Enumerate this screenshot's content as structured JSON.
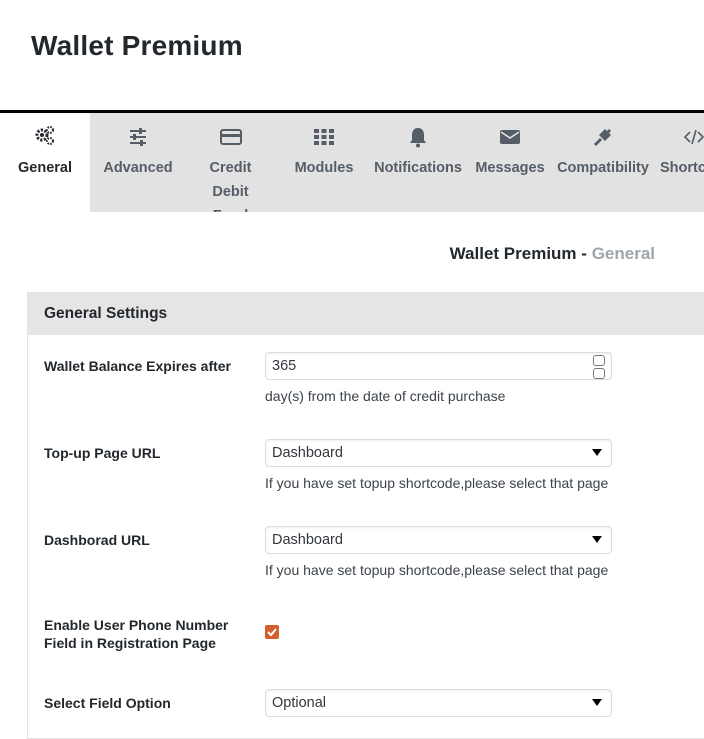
{
  "app": {
    "title": "Wallet Premium"
  },
  "tabs": [
    {
      "label": "General",
      "icon": "gears-icon",
      "active": true
    },
    {
      "label": "Advanced",
      "icon": "sliders-icon",
      "active": false
    },
    {
      "label": "Credit Debit Fund",
      "icon": "credit-card-icon",
      "active": false
    },
    {
      "label": "Modules",
      "icon": "grid-icon",
      "active": false
    },
    {
      "label": "Notifications",
      "icon": "bell-icon",
      "active": false
    },
    {
      "label": "Messages",
      "icon": "envelope-icon",
      "active": false
    },
    {
      "label": "Compatibility",
      "icon": "plug-icon",
      "active": false
    },
    {
      "label": "Shortcodes",
      "icon": "code-icon",
      "active": false
    }
  ],
  "page": {
    "title": "Wallet Premium",
    "separator": "-",
    "section": "General"
  },
  "panel": {
    "title": "General Settings",
    "fields": [
      {
        "label": "Wallet Balance Expires after",
        "value": "365",
        "description": "day(s) from the date of credit purchase"
      },
      {
        "label": "Top-up Page URL",
        "value": "Dashboard",
        "description": "If you have set topup shortcode,please select that page"
      },
      {
        "label": "Dashborad URL",
        "value": "Dashboard",
        "description": "If you have set topup shortcode,please select that page"
      },
      {
        "label": "Enable User Phone Number Field in Registration Page",
        "checked": true
      },
      {
        "label": "Select Field Option",
        "value": "Optional"
      }
    ]
  },
  "colors": {
    "accent": "#d35f2e",
    "tab_bg": "#e2e2e2",
    "panel_head": "#e5e5e5"
  }
}
